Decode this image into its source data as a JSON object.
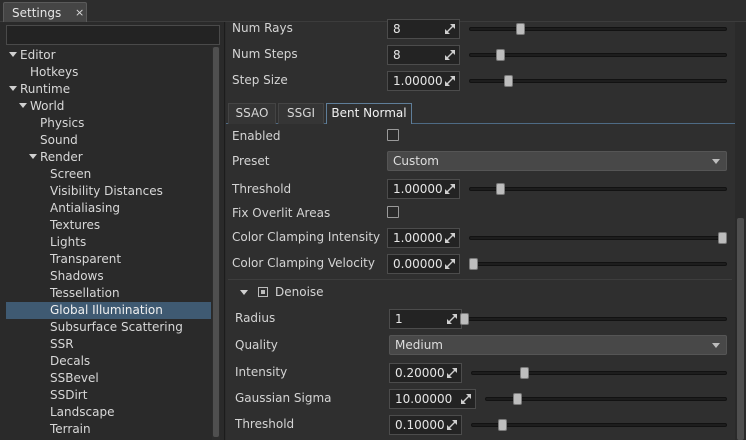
{
  "window_tab": {
    "title": "Settings",
    "close": "×"
  },
  "search": {
    "placeholder": ""
  },
  "tree": [
    {
      "label": "Editor",
      "expanded": true
    },
    {
      "label": "Hotkeys"
    },
    {
      "label": "Runtime",
      "expanded": true
    },
    {
      "label": "World",
      "expanded": true
    },
    {
      "label": "Physics"
    },
    {
      "label": "Sound"
    },
    {
      "label": "Render",
      "expanded": true
    },
    {
      "label": "Screen"
    },
    {
      "label": "Visibility Distances"
    },
    {
      "label": "Antialiasing"
    },
    {
      "label": "Textures"
    },
    {
      "label": "Lights"
    },
    {
      "label": "Transparent"
    },
    {
      "label": "Shadows"
    },
    {
      "label": "Tessellation"
    },
    {
      "label": "Global Illumination",
      "selected": true
    },
    {
      "label": "Subsurface Scattering"
    },
    {
      "label": "SSR"
    },
    {
      "label": "Decals"
    },
    {
      "label": "SSBevel"
    },
    {
      "label": "SSDirt"
    },
    {
      "label": "Landscape"
    },
    {
      "label": "Terrain"
    }
  ],
  "top_params": [
    {
      "label": "Num Rays",
      "value": "8",
      "slider_level": 0.19
    },
    {
      "label": "Num Steps",
      "value": "8",
      "slider_level": 0.11
    },
    {
      "label": "Step Size",
      "value": "1.00000",
      "slider_level": 0.14
    }
  ],
  "subtabs": [
    {
      "label": "SSAO"
    },
    {
      "label": "SSGI"
    },
    {
      "label": "Bent Normal",
      "active": true
    }
  ],
  "bent_normal": {
    "enabled_label": "Enabled",
    "preset_label": "Preset",
    "preset_value": "Custom",
    "threshold_label": "Threshold",
    "threshold_value": "1.00000",
    "threshold_level": 0.11,
    "fix_overlit_label": "Fix Overlit Areas",
    "cci_label": "Color Clamping Intensity",
    "cci_value": "1.00000",
    "cci_level": 1.0,
    "ccv_label": "Color Clamping Velocity",
    "ccv_value": "0.00000",
    "ccv_level": 0.0
  },
  "denoise": {
    "label": "Denoise",
    "radius_label": "Radius",
    "radius_value": "1",
    "radius_level": 0.0,
    "quality_label": "Quality",
    "quality_value": "Medium",
    "intensity_label": "Intensity",
    "intensity_value": "0.20000",
    "intensity_level": 0.2,
    "sigma_label": "Gaussian Sigma",
    "sigma_value": "10.00000",
    "sigma_level": 0.12,
    "threshold_label": "Threshold",
    "threshold_value": "0.10000",
    "threshold_level": 0.11
  },
  "colors": {
    "accent": "#3f5a72",
    "panel": "#2f2f2f",
    "selection": "#3f5a72"
  }
}
